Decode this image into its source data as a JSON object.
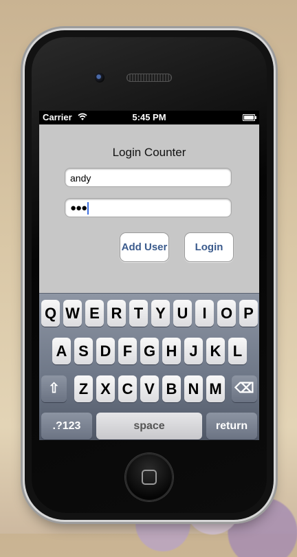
{
  "status_bar": {
    "carrier": "Carrier",
    "time": "5:45 PM"
  },
  "app": {
    "title": "Login Counter",
    "username_value": "andy",
    "password_value": "●●●",
    "add_user_label": "Add User",
    "login_label": "Login"
  },
  "keyboard": {
    "row1": [
      "Q",
      "W",
      "E",
      "R",
      "T",
      "Y",
      "U",
      "I",
      "O",
      "P"
    ],
    "row2": [
      "A",
      "S",
      "D",
      "F",
      "G",
      "H",
      "J",
      "K",
      "L"
    ],
    "row3": [
      "Z",
      "X",
      "C",
      "V",
      "B",
      "N",
      "M"
    ],
    "shift": "⇧",
    "backspace": "⌫",
    "numbers_label": ".?123",
    "space_label": "space",
    "return_label": "return"
  },
  "colors": {
    "accent_button_text": "#3a5a8c",
    "caret": "#3c6ee0"
  }
}
